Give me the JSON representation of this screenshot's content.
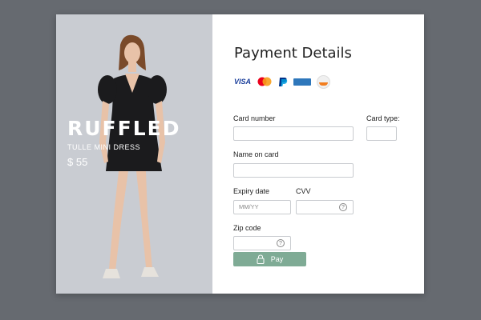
{
  "product": {
    "title": "RUFFLED",
    "subtitle": "TULLE MINI DRESS",
    "price": "$ 55"
  },
  "form": {
    "title": "Payment Details",
    "card_logos": [
      "visa",
      "mastercard",
      "paypal",
      "american-express",
      "discover"
    ],
    "visa_text": "VISA",
    "card_number_label": "Card number",
    "card_type_label": "Card type:",
    "name_label": "Name on card",
    "expiry_label": "Expiry date",
    "expiry_placeholder": "MM/YY",
    "cvv_label": "CVV",
    "zip_label": "Zip code",
    "help_glyph": "?",
    "pay_label": "Pay"
  },
  "colors": {
    "background": "#666a70",
    "product_panel": "#c9ccd2",
    "pay_button": "#7fab95"
  }
}
